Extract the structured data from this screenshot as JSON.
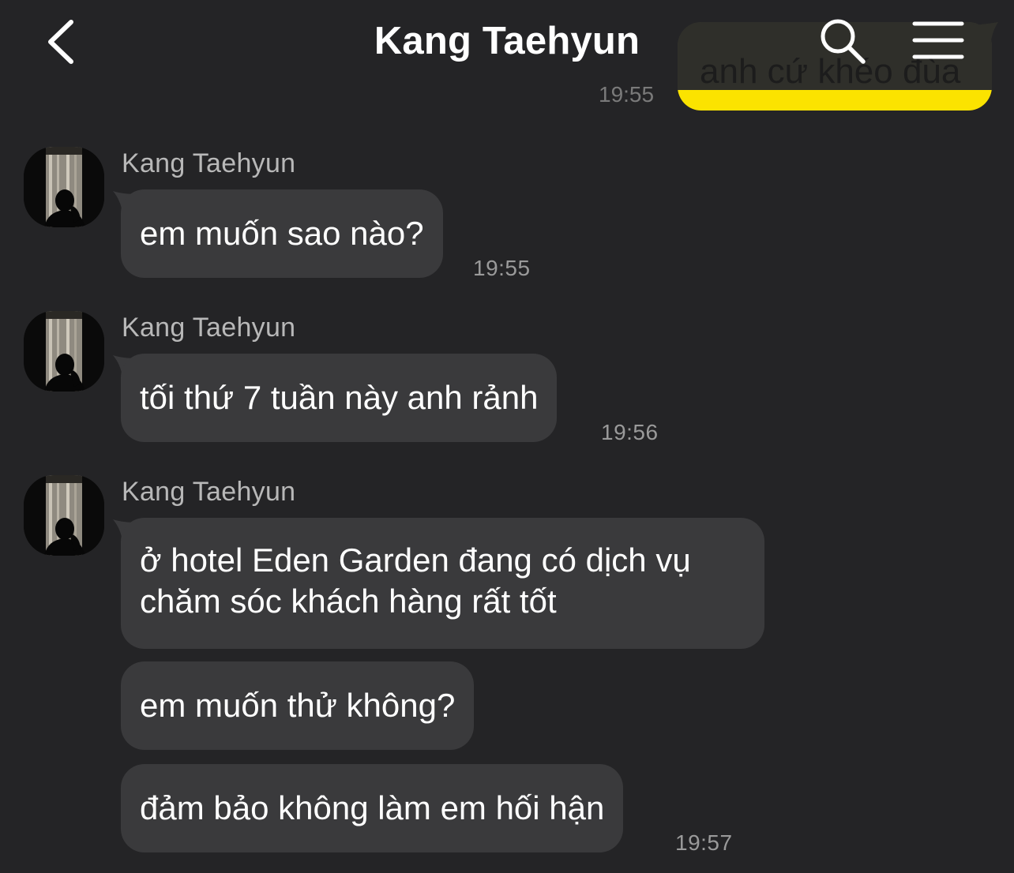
{
  "header": {
    "title": "Kang Taehyun"
  },
  "outgoing": {
    "text": "anh cứ khéo đùa",
    "time": "19:55",
    "bubble_color": "#FBE300"
  },
  "messages": [
    {
      "sender": "Kang Taehyun",
      "texts": [
        "em muốn sao nào?"
      ],
      "time": "19:55"
    },
    {
      "sender": "Kang Taehyun",
      "texts": [
        "tối thứ 7 tuần này anh rảnh"
      ],
      "time": "19:56"
    },
    {
      "sender": "Kang Taehyun",
      "texts": [
        "ở hotel Eden Garden đang có dịch vụ chăm sóc khách hàng rất tốt",
        "em muốn thử không?",
        "đảm bảo không làm em hối hận"
      ],
      "time": "19:57"
    }
  ],
  "icons": {
    "back": "chevron-left-icon",
    "search": "search-icon",
    "menu": "menu-icon"
  },
  "colors": {
    "background": "#242426",
    "incoming_bubble": "#3A3A3C",
    "timestamp": "#9A9A9A"
  }
}
